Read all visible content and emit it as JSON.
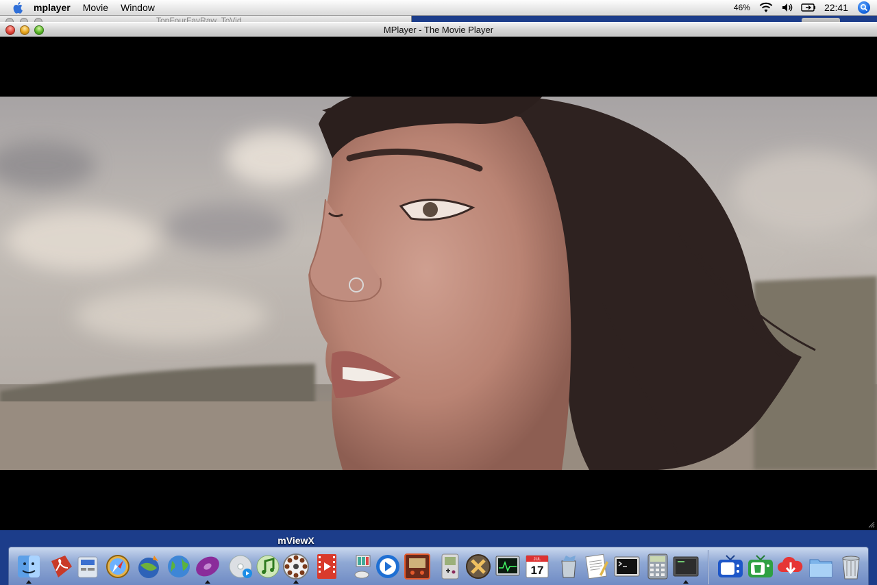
{
  "menubar": {
    "app_name": "mplayer",
    "items": [
      "Movie",
      "Window"
    ],
    "battery_percent": "46%",
    "clock": "22:41"
  },
  "background_window": {
    "title": "TopFourFavRaw_ToVid"
  },
  "window": {
    "title": "MPlayer - The Movie Player"
  },
  "dock": {
    "hover_label": "mViewX",
    "apps": [
      {
        "name": "finder-icon",
        "running": true
      },
      {
        "name": "acrobat-reader-icon",
        "running": false
      },
      {
        "name": "preferences-icon",
        "running": false
      },
      {
        "name": "safari-icon",
        "running": false
      },
      {
        "name": "camino-icon",
        "running": false
      },
      {
        "name": "network-globe-icon",
        "running": false
      },
      {
        "name": "disc-burner-icon",
        "running": true
      },
      {
        "name": "dvd-player-icon",
        "running": false
      },
      {
        "name": "itunes-icon",
        "running": false
      },
      {
        "name": "mviewx-icon",
        "running": true
      },
      {
        "name": "movie-film-icon",
        "running": false
      },
      {
        "name": "image-capture-icon",
        "running": false
      },
      {
        "name": "quicktime-icon",
        "running": false
      },
      {
        "name": "audio-player-icon",
        "running": false
      },
      {
        "name": "gameboy-emulator-icon",
        "running": false
      },
      {
        "name": "mac-os-x-icon",
        "running": false
      },
      {
        "name": "activity-monitor-icon",
        "running": false
      },
      {
        "name": "ical-icon",
        "running": false,
        "date": "17",
        "month": "JUL"
      },
      {
        "name": "trash-cleaner-icon",
        "running": false
      },
      {
        "name": "textedit-icon",
        "running": false
      },
      {
        "name": "terminal-icon",
        "running": false
      },
      {
        "name": "calculator-icon",
        "running": false
      },
      {
        "name": "console-icon",
        "running": true
      },
      {
        "name": "tv-icon",
        "running": false
      },
      {
        "name": "tv-trash-icon",
        "running": false
      },
      {
        "name": "cloud-download-icon",
        "running": false
      },
      {
        "name": "documents-folder-icon",
        "running": false
      },
      {
        "name": "trash-icon",
        "running": false
      }
    ]
  },
  "colors": {
    "desktop": "#1c3d8a",
    "video_letterbox": "#000000",
    "menubar": "#ececec"
  }
}
